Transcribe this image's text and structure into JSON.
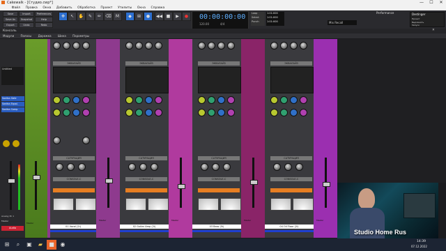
{
  "window": {
    "title": "Cakewalk - [Студио.cwp*]",
    "minimize": "—",
    "maximize": "☐",
    "close": "✕"
  },
  "menu": [
    "Файл",
    "Правка",
    "Окна",
    "Добавить",
    "Обработка",
    "Проект",
    "Утилиты",
    "Окна",
    "Справка"
  ],
  "toolbar": {
    "left_buttons": [
      "Save",
      "Import",
      "Preferences",
      "Save As",
      "Snapshot",
      "Help",
      "Export",
      "Undo",
      "Redo"
    ],
    "tools": [
      "Smart",
      "Select",
      "Move",
      "Edit",
      "Draw",
      "Erase",
      "Mute",
      "Markers",
      "Snap"
    ],
    "timecode": "00:00:00:00",
    "tempo": "120.00",
    "meter": "4/4",
    "track_fields": [
      "Loop",
      "Select",
      "Punch"
    ],
    "loop_values": [
      "1:01:000",
      "1:01:000",
      "1:01:000"
    ],
    "mix_recall": "Mix Recall",
    "performance_label": "Performance",
    "device": "Destinger",
    "device_lines": [
      "Проект",
      "Выровнять",
      "Запуск"
    ]
  },
  "console": {
    "title": "Консоль",
    "panel_title": "Модули",
    "view_items": [
      "Модули",
      "Полосы",
      "Дорожка",
      "Шина",
      "Параметры"
    ]
  },
  "strips": [
    {
      "name": "01 Vocal (2i)",
      "color": "#8e3a8e",
      "eq": "ЭКВАЛАЙЗ",
      "sat": "САТУРАЦИЯ",
      "console": "CONSOLE-C",
      "out": "Master",
      "in": "Analog 3h 1"
    },
    {
      "name": "02 Guitar Amp (2i)",
      "color": "#b03a9e",
      "eq": "ЭКВАЛАЙЗ",
      "sat": "САТУРАЦИЯ",
      "console": "CONSOLE-C",
      "out": "Master",
      "in": "Analog 3h 1"
    },
    {
      "name": "03 Bass (5i)",
      "color": "#8a2468",
      "eq": "ЭКВАЛАЙЗ",
      "sat": "САТУРАЦИЯ",
      "console": "CONSOLE-C",
      "out": "Master",
      "in": "Analog 3h 1"
    },
    {
      "name": "04 Oil Floor (2i)",
      "color": "#9b2fb0",
      "eq": "ЭКВАЛАЙЗ",
      "sat": "САТУРАЦИЯ",
      "console": "CONSOLE-C",
      "out": "Master",
      "in": "Analog 3h 1"
    }
  ],
  "master_strip": {
    "name": "Audio",
    "label": "Master"
  },
  "sends": [
    "Sonitus Gate",
    "Sonitus Equal.",
    "Sonitus Comp."
  ],
  "overlay_text": "Studio Home Rus",
  "taskbar": {
    "time": "14:39",
    "date": "07.12.2022"
  },
  "colors": {
    "accent": "#2d6fd0",
    "timecode": "#5fb0ff",
    "bluebar": "#1f3fd0"
  }
}
